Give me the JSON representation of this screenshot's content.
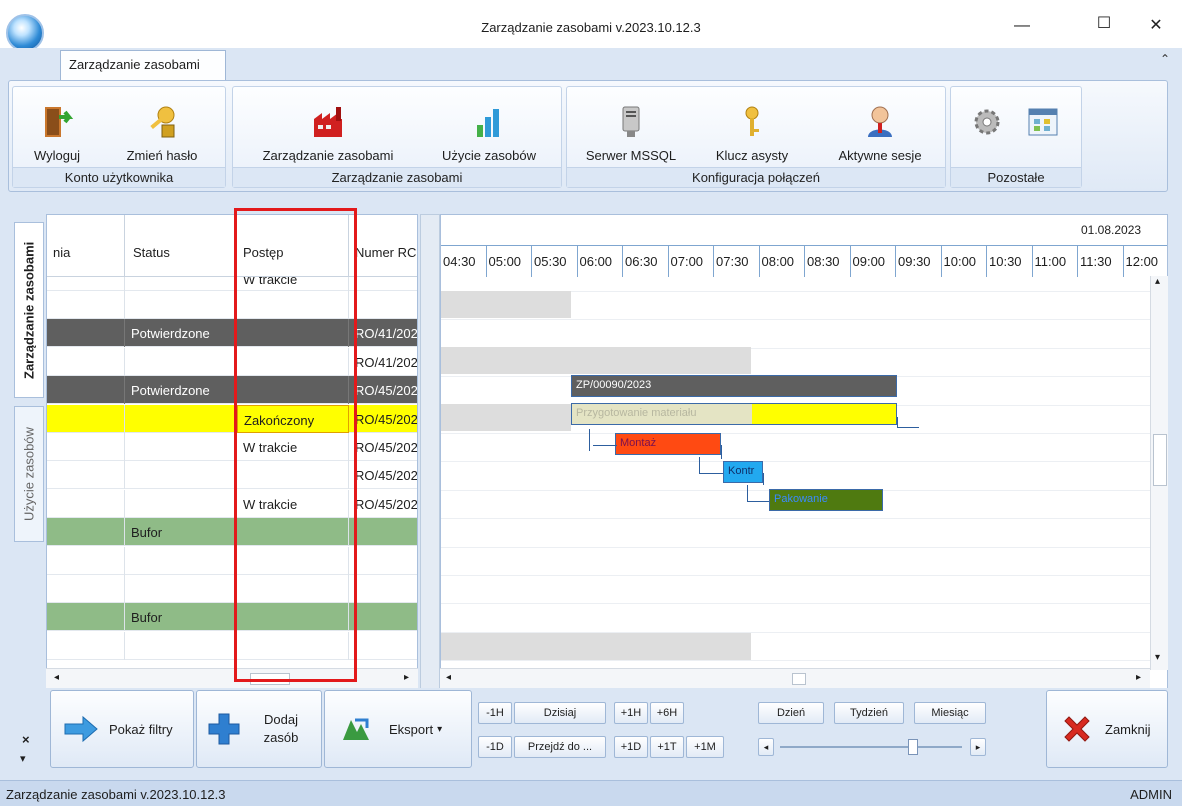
{
  "window": {
    "title": "Zarządzanie zasobami v.2023.10.12.3",
    "minimize": "—",
    "maximize": "☐",
    "close": "✕"
  },
  "ribbon_tab": "Zarządzanie zasobami",
  "ribbon_collapse": "⌃",
  "ribbon": {
    "groups": [
      {
        "label": "Konto użytkownika",
        "buttons": [
          {
            "label": "Wyloguj",
            "icon": "logout-door-icon"
          },
          {
            "label": "Zmień hasło",
            "icon": "key-lock-icon"
          }
        ]
      },
      {
        "label": "Zarządzanie zasobami",
        "buttons": [
          {
            "label": "Zarządzanie zasobami",
            "icon": "factory-icon"
          },
          {
            "label": "Użycie zasobów",
            "icon": "bar-chart-icon"
          }
        ]
      },
      {
        "label": "Konfiguracja połączeń",
        "buttons": [
          {
            "label": "Serwer MSSQL",
            "icon": "server-icon"
          },
          {
            "label": "Klucz asysty",
            "icon": "key-icon"
          },
          {
            "label": "Aktywne sesje",
            "icon": "user-session-icon"
          }
        ]
      },
      {
        "label": "Pozostałe",
        "buttons": [
          {
            "label": "",
            "icon": "gear-icon"
          },
          {
            "label": "",
            "icon": "calendar-window-icon"
          }
        ]
      }
    ]
  },
  "side_tabs": [
    "Zarządzanie zasobami",
    "Użycie zasobów"
  ],
  "side_close": "×",
  "side_arrow": "▾",
  "grid": {
    "columns": [
      "nia",
      "Status",
      "Postęp",
      "Numer RC"
    ],
    "rows": [
      {
        "col1": "",
        "status": "",
        "postep": "W trakcie",
        "numer": "",
        "style": "cut"
      },
      {
        "col1": "",
        "status": "",
        "postep": "",
        "numer": "",
        "style": "white"
      },
      {
        "col1": "",
        "status": "Potwierdzone",
        "postep": "",
        "numer": "RO/41/202",
        "style": "dark"
      },
      {
        "col1": "",
        "status": "",
        "postep": "",
        "numer": "RO/41/202",
        "style": "white"
      },
      {
        "col1": "",
        "status": "Potwierdzone",
        "postep": "",
        "numer": "RO/45/202",
        "style": "dark"
      },
      {
        "col1": "",
        "status": "",
        "postep": "Zakończony",
        "numer": "RO/45/202",
        "style": "yellow"
      },
      {
        "col1": "",
        "status": "",
        "postep": "W trakcie",
        "numer": "RO/45/202",
        "style": "white"
      },
      {
        "col1": "",
        "status": "",
        "postep": "",
        "numer": "RO/45/202",
        "style": "white"
      },
      {
        "col1": "",
        "status": "",
        "postep": "W trakcie",
        "numer": "RO/45/202",
        "style": "white"
      },
      {
        "col1": "",
        "status": "Bufor",
        "postep": "",
        "numer": "",
        "style": "green"
      },
      {
        "col1": "",
        "status": "",
        "postep": "",
        "numer": "",
        "style": "white"
      },
      {
        "col1": "",
        "status": "",
        "postep": "",
        "numer": "",
        "style": "white"
      },
      {
        "col1": "",
        "status": "Bufor",
        "postep": "",
        "numer": "",
        "style": "green"
      },
      {
        "col1": "",
        "status": "",
        "postep": "",
        "numer": "",
        "style": "white"
      }
    ]
  },
  "gantt": {
    "date": "01.08.2023",
    "times": [
      "04:30",
      "05:00",
      "05:30",
      "06:00",
      "06:30",
      "07:00",
      "07:30",
      "08:00",
      "08:30",
      "09:00",
      "09:30",
      "10:00",
      "10:30",
      "11:00",
      "11:30",
      "12:00"
    ],
    "bars": {
      "order": "ZP/00090/2023",
      "prep": "Przygotowanie materiału",
      "montaz": "Montaż",
      "kontr": "Kontr",
      "pakowanie": "Pakowanie"
    }
  },
  "bottom": {
    "filters": "Pokaż filtry",
    "add": "Dodaj zasób",
    "export": "Eksport",
    "export_arrow": "▾",
    "nav_row1": [
      "-1H",
      "Dzisiaj",
      "+1H",
      "+6H"
    ],
    "nav_row2": [
      "-1D",
      "Przejdź do ...",
      "+1D",
      "+1T",
      "+1M"
    ],
    "views": [
      "Dzień",
      "Tydzień",
      "Miesiąc"
    ],
    "close": "Zamknij"
  },
  "status": {
    "left": "Zarządzanie zasobami v.2023.10.12.3",
    "right": "ADMIN"
  },
  "colors": {
    "dark_row": "#5f5f5f",
    "yellow_row": "#ffff00",
    "green_row": "#8fbb87",
    "highlight": "#e3191b",
    "bar_order": "#5f5f5f",
    "bar_prep": "#ffff00",
    "bar_montaz": "#ff4a12",
    "bar_kontr": "#22a9f0",
    "bar_pak": "#4f7a10"
  }
}
